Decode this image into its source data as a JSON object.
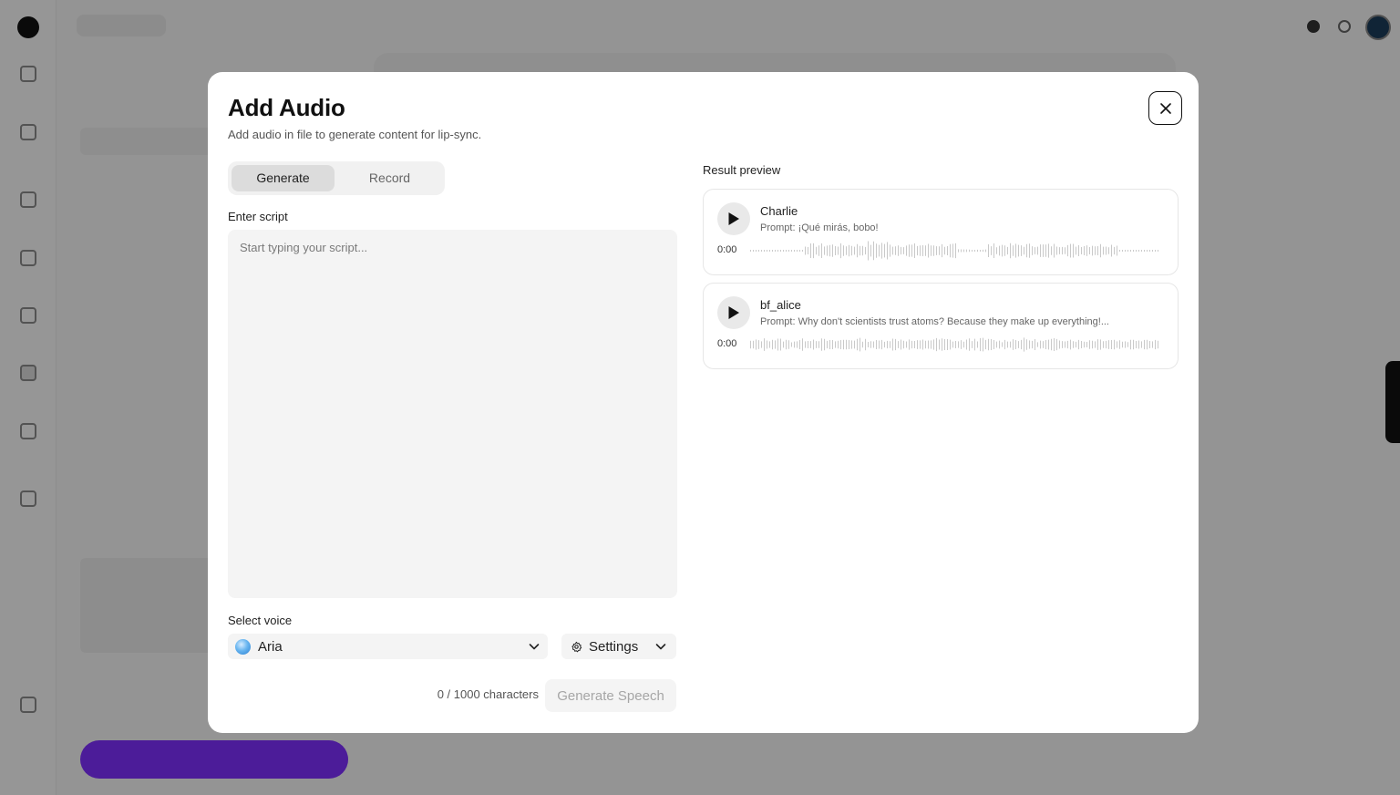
{
  "modal": {
    "title": "Add Audio",
    "subtitle": "Add audio in file to generate content for lip-sync.",
    "tabs": [
      {
        "label": "Generate",
        "active": true
      },
      {
        "label": "Record",
        "active": false
      }
    ],
    "script": {
      "label": "Enter script",
      "placeholder": "Start typing your script...",
      "value": ""
    },
    "voice": {
      "label": "Select voice",
      "selected": "Aria",
      "settings_label": "Settings"
    },
    "char_count": "0 / 1000 characters",
    "generate_button": "Generate Speech",
    "result_preview": {
      "label": "Result preview",
      "items": [
        {
          "voice": "Charlie",
          "prompt": "Prompt: ¡Qué mirás, bobo!",
          "time": "0:00"
        },
        {
          "voice": "bf_alice",
          "prompt": "Prompt: Why don't scientists trust atoms? Because they make up everything!...",
          "time": "0:00"
        }
      ]
    }
  },
  "colors": {
    "accent_purple": "#7f2fff",
    "overlay": "rgba(0,0,0,0.40)",
    "waveform": "#c9c9c9"
  },
  "icons": {
    "close": "close-icon",
    "play": "play-icon",
    "chevron": "chevron-down-icon",
    "settings": "gear-icon"
  }
}
